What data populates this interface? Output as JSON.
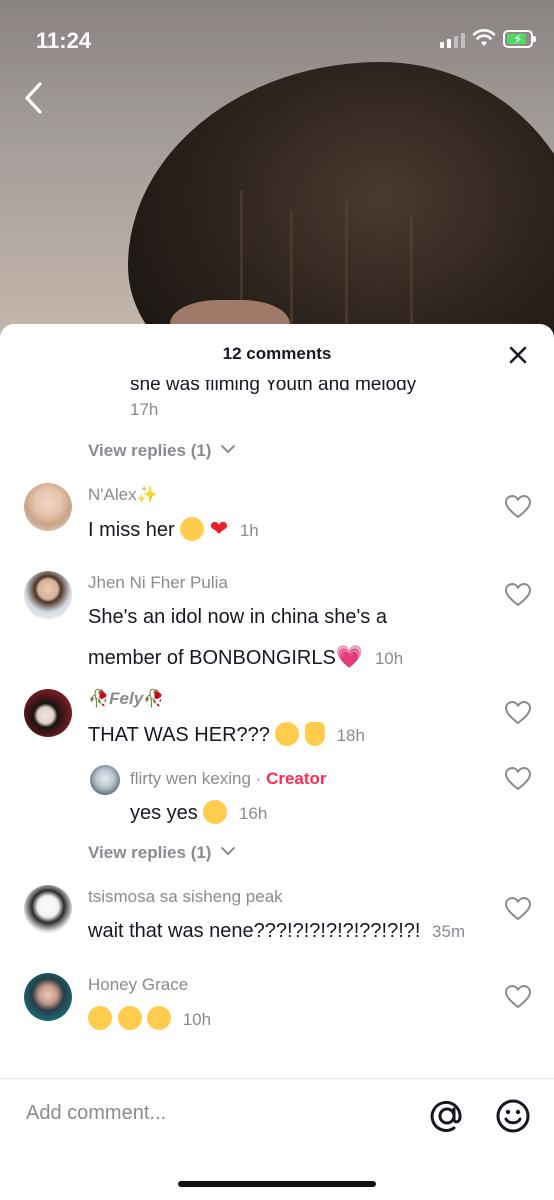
{
  "status_bar": {
    "time": "11:24"
  },
  "sheet": {
    "title": "12 comments",
    "partial_comment": {
      "text": "she was filming Youth and melody",
      "time": "17h"
    },
    "view_replies_1": "View replies (1)",
    "view_replies_2": "View replies (1)"
  },
  "comments": [
    {
      "username": "N'Alex✨",
      "text": "I miss her",
      "time": "1h"
    },
    {
      "username": "Jhen Ni Fher Pulia",
      "text_line1": "She's an idol now in china she's a",
      "text_line2": "member of BONBONGIRLS",
      "time": "10h"
    },
    {
      "username": "Fely",
      "text": "THAT WAS HER???",
      "time": "18h"
    },
    {
      "username": "tsismosa sa sisheng peak",
      "text": "wait that was nene???!?!?!?!?!??!?!?!",
      "time": "35m"
    },
    {
      "username": "Honey Grace",
      "text": "",
      "time": "10h"
    }
  ],
  "reply": {
    "username": "flirty wen kexing",
    "separator": "·",
    "badge": "Creator",
    "text": "yes yes",
    "time": "16h"
  },
  "input": {
    "placeholder": "Add comment..."
  },
  "colors": {
    "accent": "#fe2c55",
    "muted": "#8a8b91",
    "text": "#161823"
  }
}
